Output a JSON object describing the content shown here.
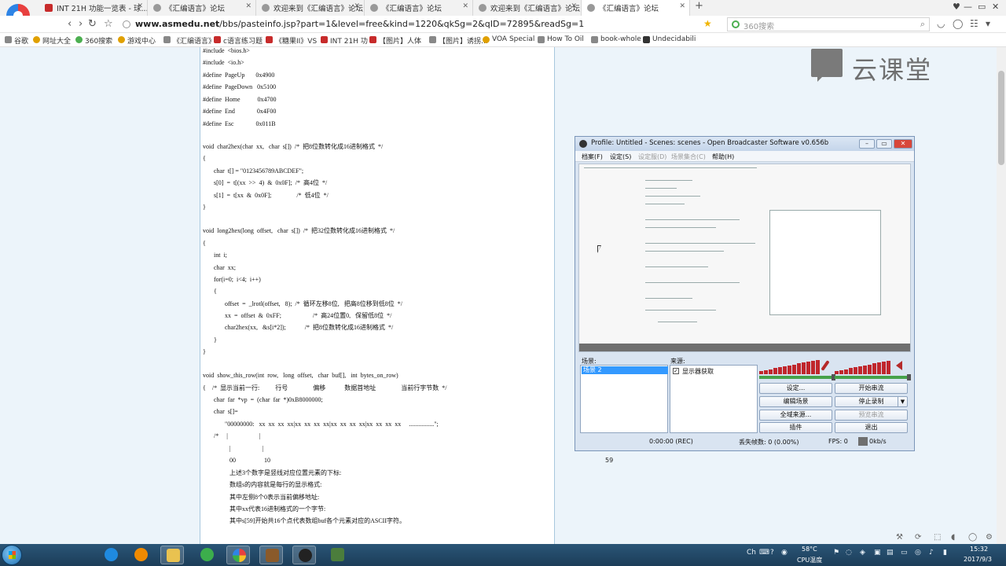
{
  "browser": {
    "tabs": [
      {
        "title": "INT 21H 功能一览表 - 球...",
        "active": false
      },
      {
        "title": "《汇编语言》论坛",
        "active": false
      },
      {
        "title": "欢迎来到《汇编语言》论坛",
        "active": false
      },
      {
        "title": "《汇编语言》论坛",
        "active": false
      },
      {
        "title": "欢迎来到《汇编语言》论坛",
        "active": false
      },
      {
        "title": "《汇编语言》论坛",
        "active": true
      }
    ],
    "url_host": "www.asmedu.net",
    "url_path": "/bbs/pasteinfo.jsp?part=1&level=free&kind=1220&qkSg=2&qID=72895&readSg=1",
    "search_placeholder": "360搜索",
    "bookmarks": [
      "谷歌",
      "网址大全",
      "360搜索",
      "游戏中心",
      "《汇编语言》",
      "c语言练习题",
      "《糖果II》VS",
      "INT 21H 功",
      "【图片】人体",
      "【图片】诱拐…",
      "VOA Special",
      "How To Oil",
      "book-whole",
      "Undecidabili"
    ]
  },
  "code_lines": [
    "#include  <bios.h>",
    "#include  <io.h>",
    "#define  PageUp       0x4900",
    "#define  PageDown   0x5100",
    "#define  Home           0x4700",
    "#define  End              0x4F00",
    "#define  Esc              0x011B",
    "void  char2hex(char  xx,   char  s[])  /*  把8位数转化成16进制格式  */",
    "{",
    "       char  t[] = \"0123456789ABCDEF\";",
    "       s[0]  =  t[(xx  >>  4)  &  0x0F];  /*  高4位  */",
    "       s[1]  =  t[xx  &  0x0F];                /*  低4位  */",
    "}",
    "void  long2hex(long  offset,   char  s[])  /*  把32位数转化成16进制格式  */",
    "{",
    "       int  i;",
    "       char  xx;",
    "       for(i=0;  i<4;  i++)",
    "       {",
    "              offset  =  _lrotl(offset,   8);  /*  循环左移8位,   把高8位移到低8位  */",
    "              xx  =  offset  &  0xFF;                    /*  高24位置0,   保留低8位  */",
    "              char2hex(xx,   &s[i*2]);            /*  把8位数转化成16进制格式  */",
    "       }",
    "}",
    "void  show_this_row(int  row,   long  offset,   char  buf[],   int  bytes_on_row)",
    "{    /*  显示当前一行:          行号                偏移            数据首地址                当前行字节数  */",
    "       char  far  *vp  =  (char  far  *)0xB8000000;",
    "       char  s[]=",
    "              \"00000000:   xx  xx  xx  xx|xx  xx  xx  xx|xx  xx  xx  xx|xx  xx  xx  xx     ................\";",
    "       /*     |                    |",
    "                 |                    |",
    "                 00                  10",
    "                 上述3个数字是竖线对应位置元素的下标:",
    "                 数组s的内容就是每行的显示格式:",
    "                 其中左侧8个0表示当前偏移地址:",
    "                 其中xx代表16进制格式的一个字节:",
    "                 其中s[59]开始共16个点代表数组buf各个元素对应的ASCII字符。"
  ],
  "page_number": "59",
  "watermark_text": "云课堂",
  "obs": {
    "title": "Profile: Untitled - Scenes: scenes - Open Broadcaster Software v0.656b",
    "menu": [
      {
        "label": "档案(F)",
        "disabled": false
      },
      {
        "label": "设定(S)",
        "disabled": false
      },
      {
        "label": "设定服(D)",
        "disabled": true
      },
      {
        "label": "场景集合(C)",
        "disabled": true
      },
      {
        "label": "帮助(H)",
        "disabled": false
      }
    ],
    "scenes_label": "场景:",
    "sources_label": "来源:",
    "scene_item": "场景 2",
    "source_item": "显示器获取",
    "buttons": {
      "settings": "设定...",
      "start_stream": "开始串流",
      "edit_scene": "编辑场景",
      "stop_record": "停止录制",
      "global_sources": "全域来源...",
      "preview_stream": "预览串流",
      "plugins": "插件",
      "exit": "退出"
    },
    "status": {
      "time": "0:00:00 (REC)",
      "dropped": "丢失帧数:  0 (0.00%)",
      "fps": "FPS:  0",
      "bitrate": "0kb/s"
    }
  },
  "tray": {
    "ime": "Ch",
    "temp": "58°C",
    "temp_label": "CPU温度",
    "time": "15:32",
    "date": "2017/9/3"
  }
}
